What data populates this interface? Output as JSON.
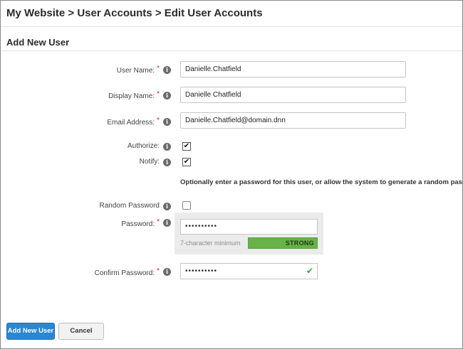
{
  "breadcrumb": "My Website > User Accounts > Edit User Accounts",
  "section_title": "Add New User",
  "required_mark": "*",
  "info_glyph": "i",
  "fields": {
    "username": {
      "label": "User Name:",
      "value": "Danielle.Chatfield"
    },
    "display": {
      "label": "Display Name:",
      "value": "Danielle Chatfield"
    },
    "email": {
      "label": "Email Address:",
      "value": "Danielle.Chatfield@domain.dnn"
    },
    "authorize": {
      "label": "Authorize:",
      "checked": true
    },
    "notify": {
      "label": "Notify:",
      "checked": true
    },
    "random": {
      "label": "Random Password",
      "checked": false
    },
    "password": {
      "label": "Password:",
      "value": "••••••••••",
      "hint": "7-character minimum",
      "strength": "STRONG",
      "strength_color": "#67b34a"
    },
    "confirm": {
      "label": "Confirm Password:",
      "value": "••••••••••",
      "match": true
    }
  },
  "password_hint": "Optionally enter a password for this user, or allow the system to generate a random password",
  "check_glyph": "✔",
  "buttons": {
    "add": "Add New User",
    "cancel": "Cancel"
  },
  "colors": {
    "primary": "#2a87d3",
    "required": "#e01c1c",
    "success": "#3aa345"
  }
}
